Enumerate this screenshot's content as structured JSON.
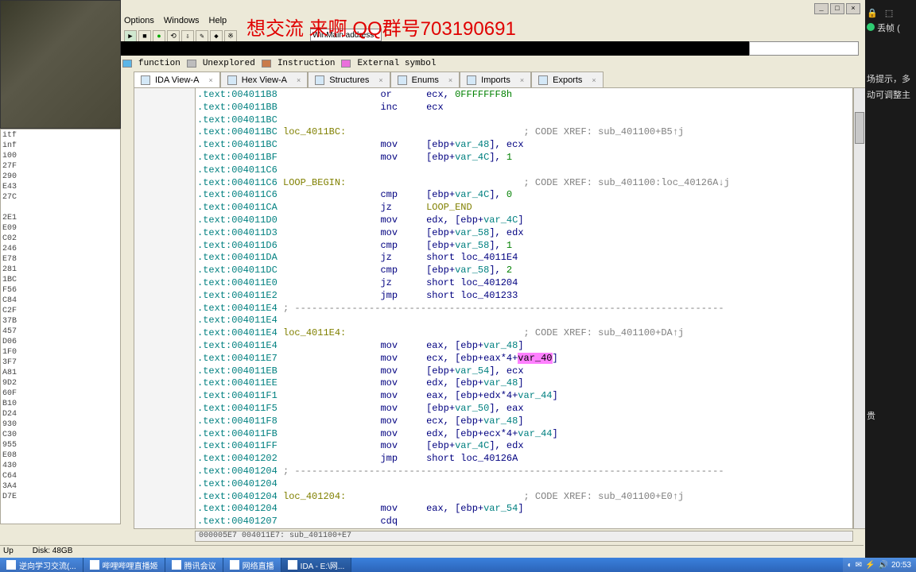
{
  "menubar": [
    "Options",
    "Windows",
    "Help"
  ],
  "overlay": "想交流   来啊   QQ群号703190691",
  "address_input": "WinMain address",
  "legend": [
    {
      "label": "function",
      "color": "#5bb5e8"
    },
    {
      "label": "Unexplored",
      "color": "#bdbdbd"
    },
    {
      "label": "Instruction",
      "color": "#c97b4a"
    },
    {
      "label": "External symbol",
      "color": "#ea6fdc"
    }
  ],
  "tabs": [
    {
      "label": "IDA View-A",
      "active": true
    },
    {
      "label": "Hex View-A",
      "active": false
    },
    {
      "label": "Structures",
      "active": false
    },
    {
      "label": "Enums",
      "active": false
    },
    {
      "label": "Imports",
      "active": false
    },
    {
      "label": "Exports",
      "active": false
    }
  ],
  "side_items": [
    "itf",
    "inf",
    "i00",
    "27F",
    "290",
    "E43",
    "27C",
    "",
    "2E1",
    "E09",
    "C02",
    "246",
    "E78",
    "281",
    "1BC",
    "F56",
    "C84",
    "C2F",
    "37B",
    "457",
    "D06",
    "1F0",
    "3F7",
    "A81",
    "9D2",
    "60F",
    "B10",
    "D24",
    "930",
    "C30",
    "955",
    "E08",
    "430",
    "C64",
    "3A4",
    "D7E"
  ],
  "code": [
    {
      "addr": ".text:004011B8",
      "mnem": "or",
      "args": "ecx, ",
      "num": "0FFFFFFF8h"
    },
    {
      "addr": ".text:004011BB",
      "mnem": "inc",
      "args": "ecx"
    },
    {
      "addr": ".text:004011BC"
    },
    {
      "addr": ".text:004011BC",
      "lbl": "loc_4011BC:",
      "xref": "; CODE XREF: sub_401100+B5↑j"
    },
    {
      "addr": ".text:004011BC",
      "mnem": "mov",
      "args": "[ebp+",
      "var": "var_48",
      "post": "], ecx"
    },
    {
      "addr": ".text:004011BF",
      "mnem": "mov",
      "args": "[ebp+",
      "var": "var_4C",
      "post": "], ",
      "num": "1"
    },
    {
      "addr": ".text:004011C6"
    },
    {
      "addr": ".text:004011C6",
      "lbl": "LOOP_BEGIN:",
      "xref": "; CODE XREF: sub_401100:loc_40126A↓j"
    },
    {
      "addr": ".text:004011C6",
      "mnem": "cmp",
      "args": "[ebp+",
      "var": "var_4C",
      "post": "], ",
      "num": "0"
    },
    {
      "addr": ".text:004011CA",
      "mnem": "jz",
      "args": "",
      "lblref": "LOOP_END"
    },
    {
      "addr": ".text:004011D0",
      "mnem": "mov",
      "args": "edx, [ebp+",
      "var": "var_4C",
      "post": "]"
    },
    {
      "addr": ".text:004011D3",
      "mnem": "mov",
      "args": "[ebp+",
      "var": "var_58",
      "post": "], edx"
    },
    {
      "addr": ".text:004011D6",
      "mnem": "cmp",
      "args": "[ebp+",
      "var": "var_58",
      "post": "], ",
      "num": "1"
    },
    {
      "addr": ".text:004011DA",
      "mnem": "jz",
      "args": "short loc_4011E4"
    },
    {
      "addr": ".text:004011DC",
      "mnem": "cmp",
      "args": "[ebp+",
      "var": "var_58",
      "post": "], ",
      "num": "2"
    },
    {
      "addr": ".text:004011E0",
      "mnem": "jz",
      "args": "short loc_401204"
    },
    {
      "addr": ".text:004011E2",
      "mnem": "jmp",
      "args": "short loc_401233"
    },
    {
      "addr": ".text:004011E4",
      "sep": "; ---------------------------------------------------------------------------"
    },
    {
      "addr": ".text:004011E4"
    },
    {
      "addr": ".text:004011E4",
      "lbl": "loc_4011E4:",
      "xref": "; CODE XREF: sub_401100+DA↑j"
    },
    {
      "addr": ".text:004011E4",
      "mnem": "mov",
      "args": "eax, [ebp+",
      "var": "var_48",
      "post": "]"
    },
    {
      "addr": ".text:004011E7",
      "mnem": "mov",
      "args": "ecx, [ebp+eax*4+",
      "hl": "var_40",
      "post": "]"
    },
    {
      "addr": ".text:004011EB",
      "mnem": "mov",
      "args": "[ebp+",
      "var": "var_54",
      "post": "], ecx"
    },
    {
      "addr": ".text:004011EE",
      "mnem": "mov",
      "args": "edx, [ebp+",
      "var": "var_48",
      "post": "]"
    },
    {
      "addr": ".text:004011F1",
      "mnem": "mov",
      "args": "eax, [ebp+edx*4+",
      "var": "var_44",
      "post": "]"
    },
    {
      "addr": ".text:004011F5",
      "mnem": "mov",
      "args": "[ebp+",
      "var": "var_50",
      "post": "], eax"
    },
    {
      "addr": ".text:004011F8",
      "mnem": "mov",
      "args": "ecx, [ebp+",
      "var": "var_48",
      "post": "]"
    },
    {
      "addr": ".text:004011FB",
      "mnem": "mov",
      "args": "edx, [ebp+ecx*4+",
      "var": "var_44",
      "post": "]"
    },
    {
      "addr": ".text:004011FF",
      "mnem": "mov",
      "args": "[ebp+",
      "var": "var_4C",
      "post": "], edx"
    },
    {
      "addr": ".text:00401202",
      "mnem": "jmp",
      "args": "short loc_40126A"
    },
    {
      "addr": ".text:00401204",
      "sep": "; ---------------------------------------------------------------------------"
    },
    {
      "addr": ".text:00401204"
    },
    {
      "addr": ".text:00401204",
      "lbl": "loc_401204:",
      "xref": "; CODE XREF: sub_401100+E0↑j"
    },
    {
      "addr": ".text:00401204",
      "mnem": "mov",
      "args": "eax, [ebp+",
      "var": "var_54",
      "post": "]"
    },
    {
      "addr": ".text:00401207",
      "mnem": "cdq",
      "args": ""
    }
  ],
  "status_code": "000005E7 004011E7: sub_401100+E7",
  "statusbar": {
    "left": "Up",
    "disk": "Disk: 48GB"
  },
  "taskbar": [
    {
      "label": "逆向学习交流(..."
    },
    {
      "label": "哔哩哔哩直播姬"
    },
    {
      "label": "腾讯会议"
    },
    {
      "label": "网络直播"
    },
    {
      "label": "IDA - E:\\网...",
      "active": true
    }
  ],
  "clock": "20:53",
  "right_panel": {
    "drop": "丢帧 (",
    "l1": "场提示，多",
    "l2": "动可调整主",
    "l3": "贵"
  }
}
